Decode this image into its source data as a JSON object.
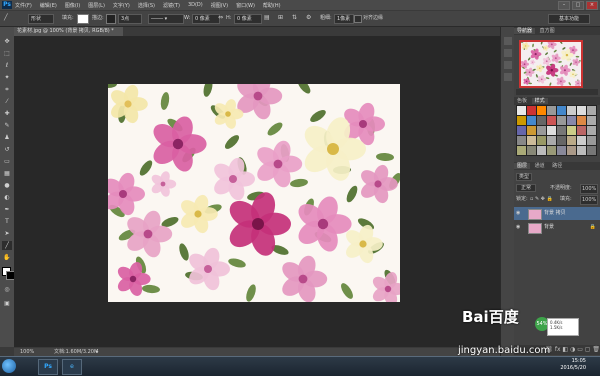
{
  "app": {
    "logo": "Ps"
  },
  "menu": [
    "文件(F)",
    "编辑(E)",
    "图像(I)",
    "图层(L)",
    "文字(Y)",
    "选择(S)",
    "滤镜(T)",
    "3D(D)",
    "视图(V)",
    "窗口(W)",
    "帮助(H)"
  ],
  "window_controls": {
    "minimize": "–",
    "maximize": "□",
    "close": "×"
  },
  "options": {
    "shape_mode": "形状",
    "fill_label": "填充:",
    "stroke_label": "描边:",
    "stroke_width": "3点",
    "w_label": "W:",
    "w_value": "0 像素",
    "h_label": "H:",
    "h_value": "0 像素",
    "weight_label": "粗细:",
    "weight_value": "1像素",
    "align_edges": "对齐边缘",
    "workspace": "基本功能"
  },
  "document": {
    "tab_title": "花素材.jpg @ 100% (背景 拷贝, RGB/8) *",
    "zoom": "100%",
    "doc_size": "文档:1.60M/3.20M"
  },
  "panels": {
    "navigator_tabs": [
      "导航器",
      "直方图"
    ],
    "swatch_tabs": [
      "色板",
      "样式"
    ],
    "layers_tabs": [
      "图层",
      "通道",
      "路径"
    ],
    "kind_label": "类型",
    "blend_mode": "正常",
    "opacity_label": "不透明度:",
    "opacity_value": "100%",
    "lock_label": "锁定:",
    "fill_label": "填充:",
    "fill_value": "100%",
    "layers": [
      {
        "name": "背景 拷贝",
        "locked": false
      },
      {
        "name": "背景",
        "locked": true
      }
    ]
  },
  "taskbar": {
    "apps": [
      "Ps",
      "e"
    ],
    "time": "15:05",
    "date": "2016/5/20",
    "net_badge": "54%",
    "net_up": "0.4K/s",
    "net_down": "1.5K/s"
  },
  "watermark": {
    "brand": "Bai百度",
    "url": "jingyan.baidu.com"
  },
  "colors": {
    "accent": "#31a8ff",
    "close": "#aa3333",
    "layer_active": "#4a6a8f"
  }
}
